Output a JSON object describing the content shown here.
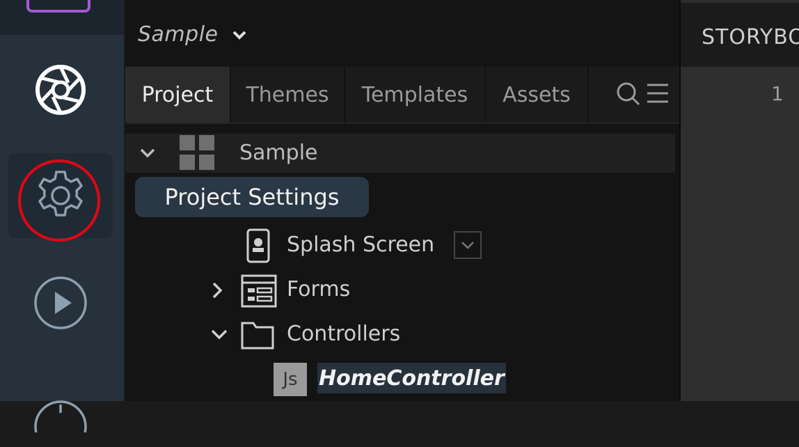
{
  "project": {
    "name": "Sample"
  },
  "tabs": [
    {
      "label": "Project",
      "active": true
    },
    {
      "label": "Themes",
      "active": false
    },
    {
      "label": "Templates",
      "active": false
    },
    {
      "label": "Assets",
      "active": false
    }
  ],
  "tree": {
    "root": "Sample",
    "tooltip": "Project Settings",
    "items": [
      {
        "label": "Splash Screen",
        "icon": "mobile-icon"
      },
      {
        "label": "Forms",
        "icon": "forms-icon"
      },
      {
        "label": "Controllers",
        "icon": "folder-icon"
      },
      {
        "label": "HomeController",
        "badge": "Js"
      }
    ]
  },
  "storyboard": {
    "title": "STORYBO",
    "line_number": "1"
  },
  "colors": {
    "highlight_ring": "#e30613",
    "rail_bg": "#26313c",
    "panel_bg": "#141414",
    "logo_accent": "#a35ad6"
  },
  "rail": {
    "icons": [
      "aperture-icon",
      "gear-icon",
      "play-icon",
      "gauge-icon"
    ]
  }
}
